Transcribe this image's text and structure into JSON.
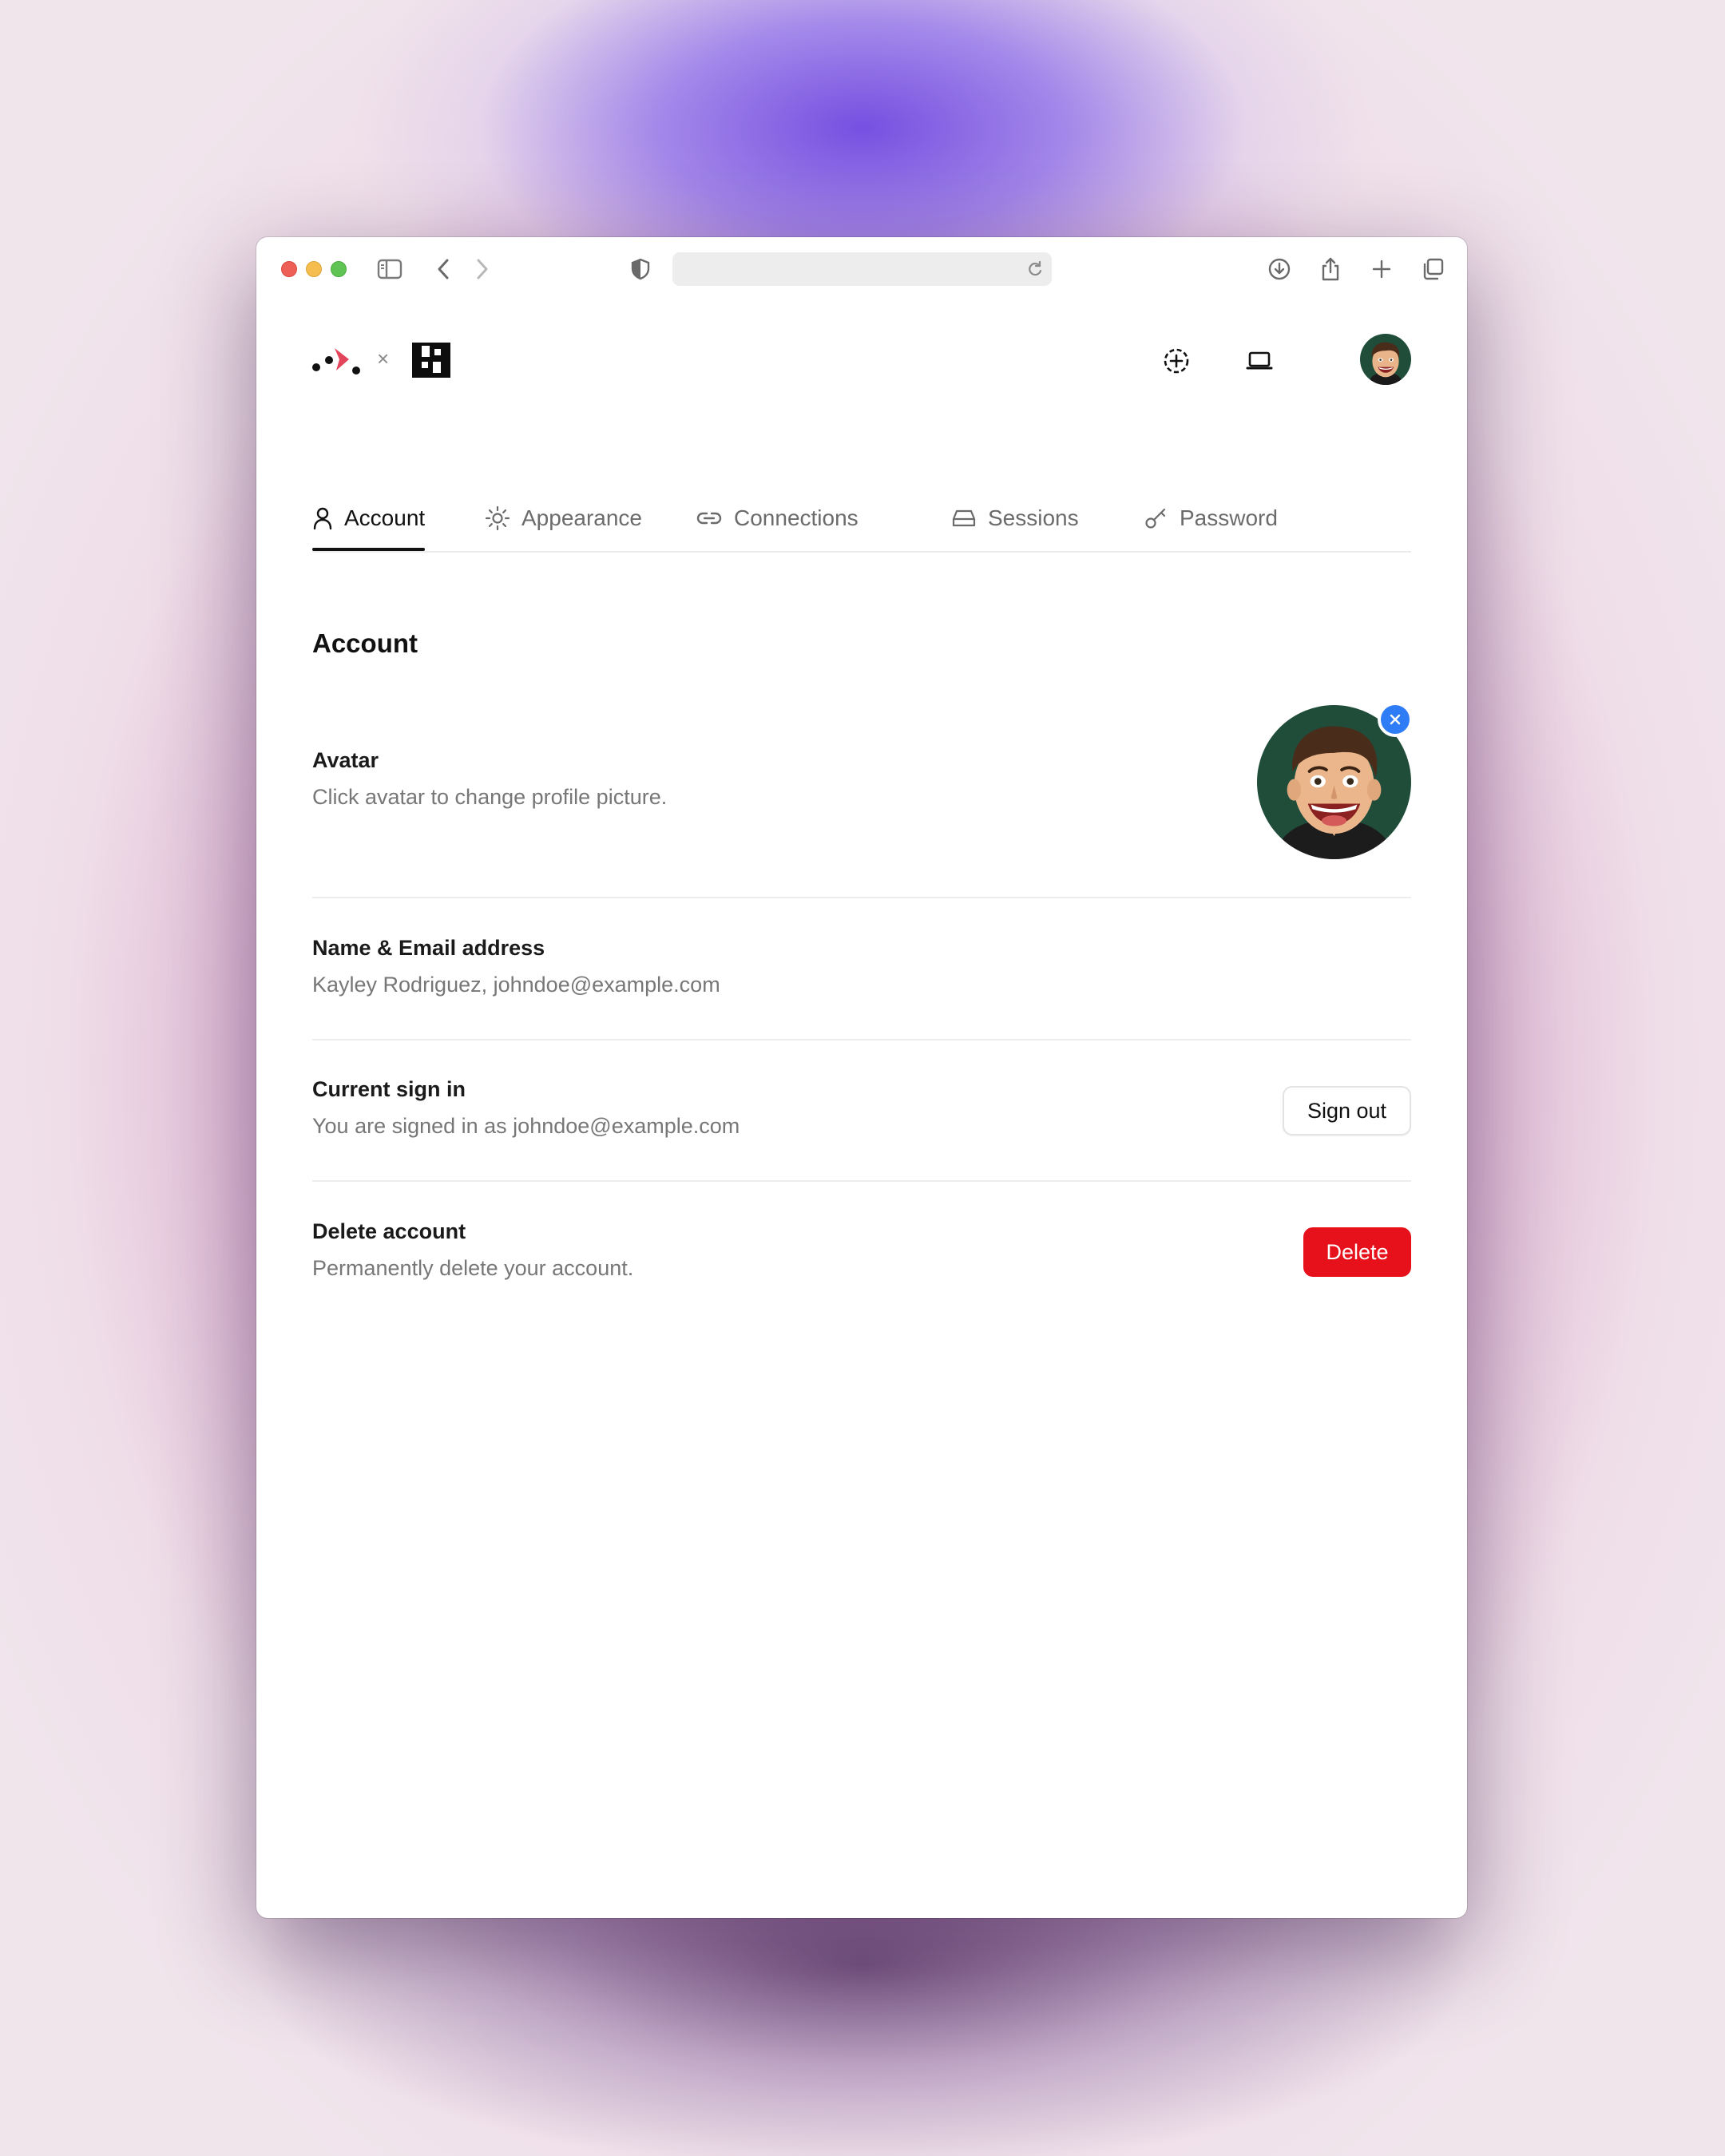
{
  "browser": {
    "url": "",
    "icons": [
      "sidebar-icon",
      "back-icon",
      "forward-icon",
      "shield-icon",
      "reload-icon",
      "download-icon",
      "share-icon",
      "new-tab-icon",
      "tabs-overview-icon"
    ]
  },
  "header": {
    "separator": "×",
    "actions": [
      "add-circle-icon",
      "laptop-icon"
    ]
  },
  "tabs": [
    {
      "label": "Account",
      "icon": "user-icon",
      "active": true
    },
    {
      "label": "Appearance",
      "icon": "sun-icon",
      "active": false
    },
    {
      "label": "Connections",
      "icon": "link-icon",
      "active": false
    },
    {
      "label": "Sessions",
      "icon": "drive-icon",
      "active": false
    },
    {
      "label": "Password",
      "icon": "key-icon",
      "active": false
    }
  ],
  "page": {
    "title": "Account",
    "avatar": {
      "title": "Avatar",
      "subtitle": "Click avatar to change profile picture."
    },
    "name_email": {
      "title": "Name & Email address",
      "subtitle": "Kayley Rodriguez, johndoe@example.com"
    },
    "current_sign_in": {
      "title": "Current sign in",
      "subtitle": "You are signed in as johndoe@example.com",
      "button": "Sign out"
    },
    "delete_account": {
      "title": "Delete account",
      "subtitle": "Permanently delete your account.",
      "button": "Delete"
    }
  },
  "colors": {
    "accent": "#2f7df6",
    "danger": "#e7111b",
    "logo_red": "#e3465a"
  }
}
